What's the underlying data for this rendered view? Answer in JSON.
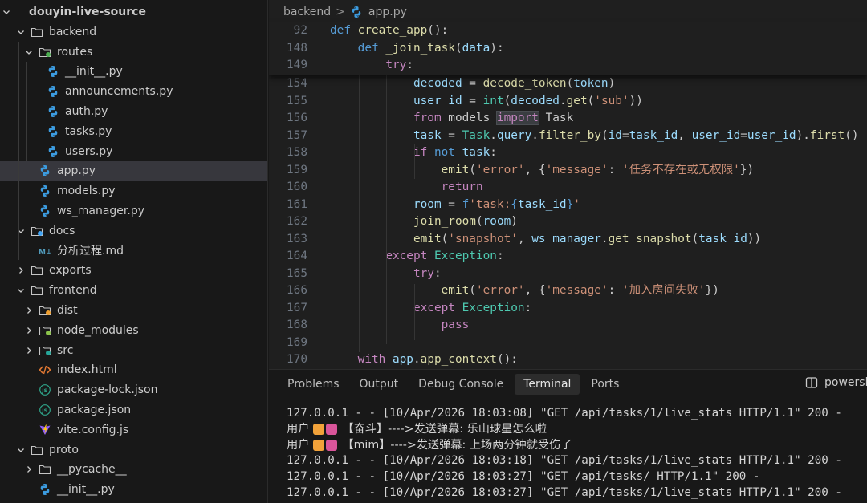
{
  "explorer": {
    "items": [
      {
        "label": "douyin-live-source",
        "chevron": "down",
        "icon": ""
      },
      {
        "label": "backend",
        "chevron": "down",
        "icon": "folder-icon"
      },
      {
        "label": "routes",
        "chevron": "down",
        "icon": "folder-routes-icon"
      },
      {
        "label": "__init__.py",
        "chevron": "",
        "icon": "python-icon"
      },
      {
        "label": "announcements.py",
        "chevron": "",
        "icon": "python-icon"
      },
      {
        "label": "auth.py",
        "chevron": "",
        "icon": "python-icon"
      },
      {
        "label": "tasks.py",
        "chevron": "",
        "icon": "python-icon"
      },
      {
        "label": "users.py",
        "chevron": "",
        "icon": "python-icon"
      },
      {
        "label": "app.py",
        "chevron": "",
        "icon": "python-icon",
        "selected": true
      },
      {
        "label": "models.py",
        "chevron": "",
        "icon": "python-icon"
      },
      {
        "label": "ws_manager.py",
        "chevron": "",
        "icon": "python-icon"
      },
      {
        "label": "docs",
        "chevron": "down",
        "icon": "folder-docs-icon"
      },
      {
        "label": "分析过程.md",
        "chevron": "",
        "icon": "markdown-icon"
      },
      {
        "label": "exports",
        "chevron": "right",
        "icon": "folder-icon"
      },
      {
        "label": "frontend",
        "chevron": "down",
        "icon": "folder-icon"
      },
      {
        "label": "dist",
        "chevron": "right",
        "icon": "folder-dist-icon"
      },
      {
        "label": "node_modules",
        "chevron": "right",
        "icon": "folder-node-icon"
      },
      {
        "label": "src",
        "chevron": "right",
        "icon": "folder-src-icon"
      },
      {
        "label": "index.html",
        "chevron": "",
        "icon": "html-icon"
      },
      {
        "label": "package-lock.json",
        "chevron": "",
        "icon": "json-icon"
      },
      {
        "label": "package.json",
        "chevron": "",
        "icon": "json-icon"
      },
      {
        "label": "vite.config.js",
        "chevron": "",
        "icon": "vite-icon"
      },
      {
        "label": "proto",
        "chevron": "down",
        "icon": "folder-icon"
      },
      {
        "label": "__pycache__",
        "chevron": "right",
        "icon": "folder-icon"
      },
      {
        "label": "__init__.py",
        "chevron": "",
        "icon": "python-icon"
      }
    ]
  },
  "breadcrumb": {
    "folder": "backend",
    "separator": ">",
    "file": "app.py"
  },
  "editor": {
    "sticky": [
      {
        "ln": "92",
        "tokens": [
          [
            "def ",
            "k"
          ],
          [
            "create_app",
            "f"
          ],
          [
            "():",
            ""
          ]
        ]
      },
      {
        "ln": "148",
        "tokens": [
          [
            "    ",
            ""
          ],
          [
            "def ",
            "k"
          ],
          [
            "_join_task",
            "f"
          ],
          [
            "(",
            ""
          ],
          [
            "data",
            "v"
          ],
          [
            "):",
            ""
          ]
        ]
      },
      {
        "ln": "149",
        "tokens": [
          [
            "        ",
            ""
          ],
          [
            "try",
            "c"
          ],
          [
            ":",
            ""
          ]
        ]
      }
    ],
    "lines": [
      {
        "ln": "154",
        "tokens": [
          [
            "            ",
            ""
          ],
          [
            "decoded",
            "v"
          ],
          [
            " = ",
            ""
          ],
          [
            "decode_token",
            "f"
          ],
          [
            "(",
            ""
          ],
          [
            "token",
            "v"
          ],
          [
            ")",
            ""
          ]
        ]
      },
      {
        "ln": "155",
        "tokens": [
          [
            "            ",
            ""
          ],
          [
            "user_id",
            "v"
          ],
          [
            " = ",
            ""
          ],
          [
            "int",
            "t"
          ],
          [
            "(",
            ""
          ],
          [
            "decoded",
            "v"
          ],
          [
            ".",
            ""
          ],
          [
            "get",
            "f"
          ],
          [
            "(",
            ""
          ],
          [
            "'sub'",
            "s"
          ],
          [
            "))",
            ""
          ]
        ]
      },
      {
        "ln": "156",
        "tokens": [
          [
            "            ",
            ""
          ],
          [
            "from",
            "c"
          ],
          [
            " models ",
            ""
          ],
          [
            "import",
            "hl c"
          ],
          [
            " Task",
            ""
          ]
        ]
      },
      {
        "ln": "157",
        "tokens": [
          [
            "            ",
            ""
          ],
          [
            "task",
            "v"
          ],
          [
            " = ",
            ""
          ],
          [
            "Task",
            "t"
          ],
          [
            ".",
            ""
          ],
          [
            "query",
            "v"
          ],
          [
            ".",
            ""
          ],
          [
            "filter_by",
            "f"
          ],
          [
            "(",
            ""
          ],
          [
            "id",
            "v"
          ],
          [
            "=",
            ""
          ],
          [
            "task_id",
            "v"
          ],
          [
            ", ",
            ""
          ],
          [
            "user_id",
            "v"
          ],
          [
            "=",
            ""
          ],
          [
            "user_id",
            "v"
          ],
          [
            ").",
            ""
          ],
          [
            "first",
            "f"
          ],
          [
            "()",
            ""
          ]
        ]
      },
      {
        "ln": "158",
        "tokens": [
          [
            "            ",
            ""
          ],
          [
            "if",
            "c"
          ],
          [
            " ",
            ""
          ],
          [
            "not",
            "k"
          ],
          [
            " ",
            ""
          ],
          [
            "task",
            "v"
          ],
          [
            ":",
            ""
          ]
        ]
      },
      {
        "ln": "159",
        "tokens": [
          [
            "                ",
            ""
          ],
          [
            "emit",
            "f"
          ],
          [
            "(",
            ""
          ],
          [
            "'error'",
            "s"
          ],
          [
            ", {",
            ""
          ],
          [
            "'message'",
            "s"
          ],
          [
            ": ",
            ""
          ],
          [
            "'任务不存在或无权限'",
            "s"
          ],
          [
            "})",
            ""
          ]
        ]
      },
      {
        "ln": "160",
        "tokens": [
          [
            "                ",
            ""
          ],
          [
            "return",
            "c"
          ]
        ]
      },
      {
        "ln": "161",
        "tokens": [
          [
            "            ",
            ""
          ],
          [
            "room",
            "v"
          ],
          [
            " = ",
            ""
          ],
          [
            "f",
            "k"
          ],
          [
            "'task:",
            "s"
          ],
          [
            "{",
            "k"
          ],
          [
            "task_id",
            "v"
          ],
          [
            "}",
            "k"
          ],
          [
            "'",
            "s"
          ]
        ]
      },
      {
        "ln": "162",
        "tokens": [
          [
            "            ",
            ""
          ],
          [
            "join_room",
            "f"
          ],
          [
            "(",
            ""
          ],
          [
            "room",
            "v"
          ],
          [
            ")",
            ""
          ]
        ]
      },
      {
        "ln": "163",
        "tokens": [
          [
            "            ",
            ""
          ],
          [
            "emit",
            "f"
          ],
          [
            "(",
            ""
          ],
          [
            "'snapshot'",
            "s"
          ],
          [
            ", ",
            ""
          ],
          [
            "ws_manager",
            "v"
          ],
          [
            ".",
            ""
          ],
          [
            "get_snapshot",
            "f"
          ],
          [
            "(",
            ""
          ],
          [
            "task_id",
            "v"
          ],
          [
            "))",
            ""
          ]
        ]
      },
      {
        "ln": "164",
        "tokens": [
          [
            "        ",
            ""
          ],
          [
            "except",
            "c"
          ],
          [
            " ",
            ""
          ],
          [
            "Exception",
            "t"
          ],
          [
            ":",
            ""
          ]
        ]
      },
      {
        "ln": "165",
        "tokens": [
          [
            "            ",
            ""
          ],
          [
            "try",
            "c"
          ],
          [
            ":",
            ""
          ]
        ]
      },
      {
        "ln": "166",
        "tokens": [
          [
            "                ",
            ""
          ],
          [
            "emit",
            "f"
          ],
          [
            "(",
            ""
          ],
          [
            "'error'",
            "s"
          ],
          [
            ", {",
            ""
          ],
          [
            "'message'",
            "s"
          ],
          [
            ": ",
            ""
          ],
          [
            "'加入房间失败'",
            "s"
          ],
          [
            "})",
            ""
          ]
        ]
      },
      {
        "ln": "167",
        "tokens": [
          [
            "            ",
            ""
          ],
          [
            "except",
            "c"
          ],
          [
            " ",
            ""
          ],
          [
            "Exception",
            "t"
          ],
          [
            ":",
            ""
          ]
        ]
      },
      {
        "ln": "168",
        "tokens": [
          [
            "                ",
            ""
          ],
          [
            "pass",
            "c"
          ]
        ]
      },
      {
        "ln": "169",
        "tokens": []
      },
      {
        "ln": "170",
        "tokens": [
          [
            "    ",
            ""
          ],
          [
            "with",
            "c"
          ],
          [
            " ",
            ""
          ],
          [
            "app",
            "v"
          ],
          [
            ".",
            ""
          ],
          [
            "app_context",
            "f"
          ],
          [
            "():",
            ""
          ]
        ]
      }
    ]
  },
  "panel": {
    "tabs": [
      {
        "label": "Problems",
        "active": false
      },
      {
        "label": "Output",
        "active": false
      },
      {
        "label": "Debug Console",
        "active": false
      },
      {
        "label": "Terminal",
        "active": true
      },
      {
        "label": "Ports",
        "active": false
      }
    ],
    "shell": "powershell",
    "terminal_lines": [
      {
        "text": "127.0.0.1 - - [10/Apr/2026 18:03:08] \"GET /api/tasks/1/live_stats HTTP/1.1\" 200 -",
        "cn": false
      },
      {
        "prefix": "用户",
        "text": "【奋斗】---->发送弹幕: 乐山球星怎么啦",
        "cn": true
      },
      {
        "prefix": "用户",
        "text": "【mim】---->发送弹幕: 上场两分钟就受伤了",
        "cn": true
      },
      {
        "text": "127.0.0.1 - - [10/Apr/2026 18:03:18] \"GET /api/tasks/1/live_stats HTTP/1.1\" 200 -",
        "cn": false
      },
      {
        "text": "127.0.0.1 - - [10/Apr/2026 18:03:27] \"GET /api/tasks/ HTTP/1.1\" 200 -",
        "cn": false
      },
      {
        "text": "127.0.0.1 - - [10/Apr/2026 18:03:27] \"GET /api/tasks/1/live_stats HTTP/1.1\" 200 -",
        "cn": false
      }
    ]
  },
  "colors": {
    "accent": "#0078d4",
    "selection": "#37373d",
    "editor_bg": "#1f1f1f",
    "sidebar_bg": "#181818"
  }
}
